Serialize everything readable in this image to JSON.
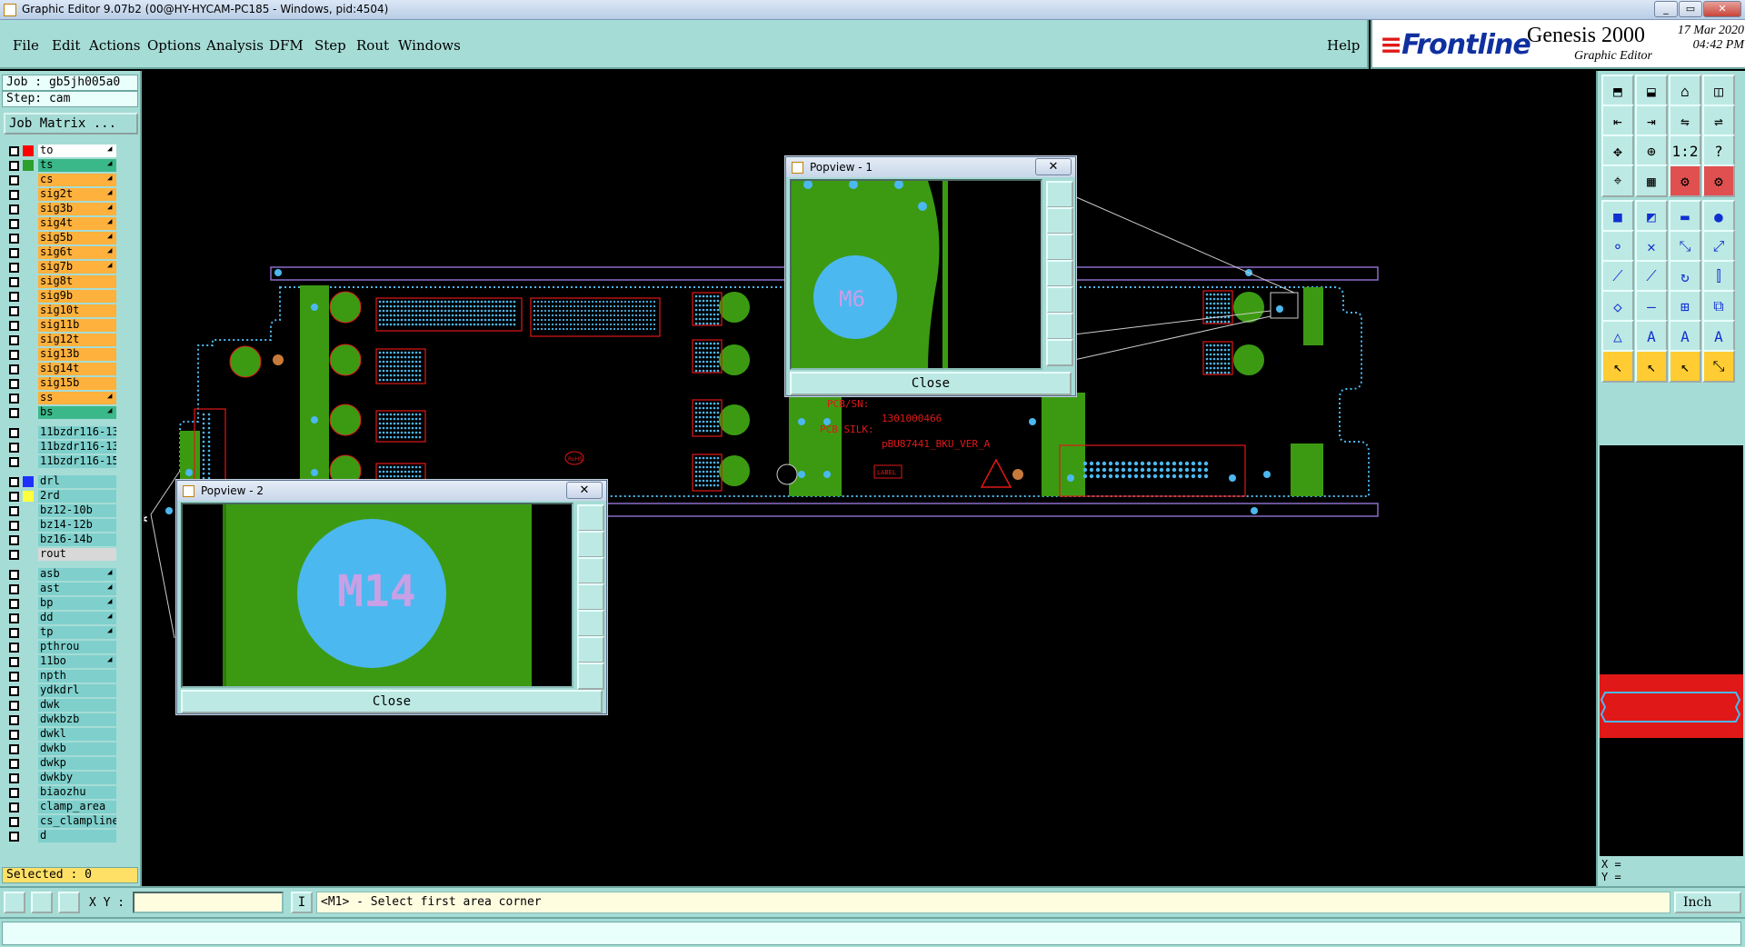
{
  "window": {
    "title": "Graphic Editor 9.07b2 (00@HY-HYCAM-PC185 - Windows, pid:4504)"
  },
  "menubar": {
    "items": [
      "File",
      "Edit",
      "Actions",
      "Options",
      "Analysis",
      "DFM",
      "Step",
      "Rout",
      "Windows"
    ],
    "help": "Help"
  },
  "brand": {
    "logo": "Frontline",
    "product": "Genesis 2000",
    "subtitle": "Graphic Editor",
    "date": "17 Mar 2020",
    "time": "04:42 PM"
  },
  "left": {
    "job": "Job : gb5jh005a0",
    "step": "Step: cam",
    "job_matrix": "Job Matrix ...",
    "selected": "Selected : 0",
    "layers": [
      {
        "name": "to",
        "bg": "#ffffff",
        "color": "#ff0000",
        "arrow": true,
        "group": 1
      },
      {
        "name": "ts",
        "bg": "#3bb88a",
        "color": "#2d9f2d",
        "arrow": true,
        "group": 1
      },
      {
        "name": "cs",
        "bg": "#ffb13d",
        "color": "",
        "arrow": true,
        "group": 1
      },
      {
        "name": "sig2t",
        "bg": "#ffb13d",
        "color": "",
        "arrow": true,
        "group": 1
      },
      {
        "name": "sig3b",
        "bg": "#ffb13d",
        "color": "",
        "arrow": true,
        "group": 1
      },
      {
        "name": "sig4t",
        "bg": "#ffb13d",
        "color": "",
        "arrow": true,
        "group": 1
      },
      {
        "name": "sig5b",
        "bg": "#ffb13d",
        "color": "",
        "arrow": true,
        "group": 1
      },
      {
        "name": "sig6t",
        "bg": "#ffb13d",
        "color": "",
        "arrow": true,
        "group": 1
      },
      {
        "name": "sig7b",
        "bg": "#ffb13d",
        "color": "",
        "arrow": true,
        "group": 1
      },
      {
        "name": "sig8t",
        "bg": "#ffb13d",
        "color": "",
        "arrow": false,
        "group": 1
      },
      {
        "name": "sig9b",
        "bg": "#ffb13d",
        "color": "",
        "arrow": false,
        "group": 1
      },
      {
        "name": "sig10t",
        "bg": "#ffb13d",
        "color": "",
        "arrow": false,
        "group": 1
      },
      {
        "name": "sig11b",
        "bg": "#ffb13d",
        "color": "",
        "arrow": false,
        "group": 1
      },
      {
        "name": "sig12t",
        "bg": "#ffb13d",
        "color": "",
        "arrow": false,
        "group": 1
      },
      {
        "name": "sig13b",
        "bg": "#ffb13d",
        "color": "",
        "arrow": false,
        "group": 1
      },
      {
        "name": "sig14t",
        "bg": "#ffb13d",
        "color": "",
        "arrow": false,
        "group": 1
      },
      {
        "name": "sig15b",
        "bg": "#ffb13d",
        "color": "",
        "arrow": false,
        "group": 1
      },
      {
        "name": "ss",
        "bg": "#ffb13d",
        "color": "",
        "arrow": true,
        "group": 1
      },
      {
        "name": "bs",
        "bg": "#3bb88a",
        "color": "",
        "arrow": true,
        "group": 1
      },
      {
        "name": "11bzdr116-13",
        "bg": "#7fd0cc",
        "color": "",
        "arrow": false,
        "group": 2
      },
      {
        "name": "11bzdr116-13",
        "bg": "#7fd0cc",
        "color": "",
        "arrow": false,
        "group": 2
      },
      {
        "name": "11bzdr116-15",
        "bg": "#7fd0cc",
        "color": "",
        "arrow": false,
        "group": 2
      },
      {
        "name": "drl",
        "bg": "#7fd0cc",
        "color": "#2030ff",
        "arrow": false,
        "group": 3
      },
      {
        "name": "2rd",
        "bg": "#7fd0cc",
        "color": "#ffff40",
        "arrow": false,
        "group": 3
      },
      {
        "name": "bz12-10b",
        "bg": "#7fd0cc",
        "color": "",
        "arrow": false,
        "group": 3
      },
      {
        "name": "bz14-12b",
        "bg": "#7fd0cc",
        "color": "",
        "arrow": false,
        "group": 3
      },
      {
        "name": "bz16-14b",
        "bg": "#7fd0cc",
        "color": "",
        "arrow": false,
        "group": 3
      },
      {
        "name": "rout",
        "bg": "#d8d8d8",
        "color": "",
        "arrow": false,
        "group": 3
      },
      {
        "name": "asb",
        "bg": "#7fd0cc",
        "color": "",
        "arrow": true,
        "group": 4
      },
      {
        "name": "ast",
        "bg": "#7fd0cc",
        "color": "",
        "arrow": true,
        "group": 4
      },
      {
        "name": "bp",
        "bg": "#7fd0cc",
        "color": "",
        "arrow": true,
        "group": 4
      },
      {
        "name": "dd",
        "bg": "#7fd0cc",
        "color": "",
        "arrow": true,
        "group": 4
      },
      {
        "name": "tp",
        "bg": "#7fd0cc",
        "color": "",
        "arrow": true,
        "group": 4
      },
      {
        "name": "pthrou",
        "bg": "#7fd0cc",
        "color": "",
        "arrow": false,
        "group": 4
      },
      {
        "name": "11bo",
        "bg": "#7fd0cc",
        "color": "",
        "arrow": true,
        "group": 4
      },
      {
        "name": "npth",
        "bg": "#7fd0cc",
        "color": "",
        "arrow": false,
        "group": 4
      },
      {
        "name": "ydkdrl",
        "bg": "#7fd0cc",
        "color": "",
        "arrow": false,
        "group": 4
      },
      {
        "name": "dwk",
        "bg": "#7fd0cc",
        "color": "",
        "arrow": false,
        "group": 4
      },
      {
        "name": "dwkbzb",
        "bg": "#7fd0cc",
        "color": "",
        "arrow": false,
        "group": 4
      },
      {
        "name": "dwkl",
        "bg": "#7fd0cc",
        "color": "",
        "arrow": false,
        "group": 4
      },
      {
        "name": "dwkb",
        "bg": "#7fd0cc",
        "color": "",
        "arrow": false,
        "group": 4
      },
      {
        "name": "dwkp",
        "bg": "#7fd0cc",
        "color": "",
        "arrow": false,
        "group": 4
      },
      {
        "name": "dwkby",
        "bg": "#7fd0cc",
        "color": "",
        "arrow": false,
        "group": 4
      },
      {
        "name": "biaozhu",
        "bg": "#7fd0cc",
        "color": "",
        "arrow": false,
        "group": 4
      },
      {
        "name": "clamp_area",
        "bg": "#7fd0cc",
        "color": "",
        "arrow": false,
        "group": 4
      },
      {
        "name": "cs_clampline",
        "bg": "#7fd0cc",
        "color": "",
        "arrow": false,
        "group": 4
      },
      {
        "name": "d",
        "bg": "#7fd0cc",
        "color": "",
        "arrow": false,
        "group": 4
      }
    ]
  },
  "canvas": {
    "pcb_sn_label": "PCB/SN:",
    "pcb_sn": "1301000466",
    "pcb_silk_label": "PCB SILK:",
    "pcb_silk": "pBU87441_BKU_VER_A",
    "label_text": "LABEL",
    "rohs": "RoHS"
  },
  "popview1": {
    "title": "Popview - 1",
    "pad_label": "M6",
    "close": "Close",
    "close_x": "✕"
  },
  "popview2": {
    "title": "Popview - 2",
    "pad_label": "M14",
    "close": "Close",
    "close_x": "✕"
  },
  "status": {
    "xy_label": "X Y :",
    "xy_value": "",
    "i_button": "I",
    "prompt": "<M1> - Select first area corner",
    "units": "Inch"
  },
  "coords": {
    "x": "X = ",
    "y": "Y = "
  },
  "colors": {
    "panel": "#a6dcd6",
    "copper": "#3c9a12",
    "pad": "#4cb8f0",
    "outline": "#8a6cc8",
    "red": "#e01818"
  }
}
